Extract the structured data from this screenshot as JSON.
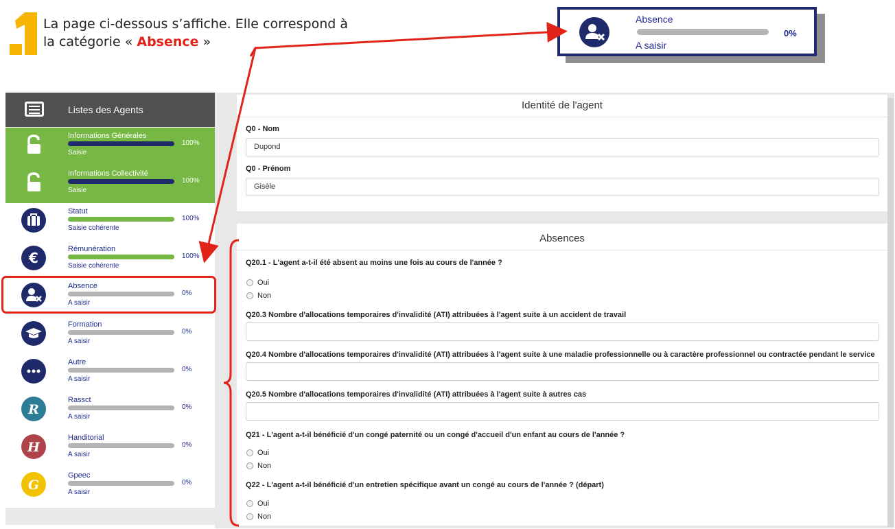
{
  "instruction": {
    "step_number": "1",
    "line1": "La page ci-dessous s’affiche. Elle correspond à",
    "line2_before": "la catégorie « ",
    "line2_highlight": "Absence",
    "line2_after": " »"
  },
  "callout": {
    "label": "Absence",
    "percent": "0%",
    "status": "A saisir",
    "progress": 0
  },
  "sidebar": {
    "header_title": "Listes des Agents",
    "items": [
      {
        "label": "Informations Générales",
        "percent": "100%",
        "status": "Saisie",
        "progress": 1.0,
        "icon": "unlock-icon"
      },
      {
        "label": "Informations Collectivité",
        "percent": "100%",
        "status": "Saisie",
        "progress": 1.0,
        "icon": "unlock-icon"
      },
      {
        "label": "Statut",
        "percent": "100%",
        "status": "Saisie cohérente",
        "progress": 1.0,
        "icon": "briefcase-icon"
      },
      {
        "label": "Rémunération",
        "percent": "100%",
        "status": "Saisie cohérente",
        "progress": 1.0,
        "icon": "euro-icon"
      },
      {
        "label": "Absence",
        "percent": "0%",
        "status": "A saisir",
        "progress": 0,
        "icon": "user-x-icon"
      },
      {
        "label": "Formation",
        "percent": "0%",
        "status": "A saisir",
        "progress": 0,
        "icon": "graduation-cap-icon"
      },
      {
        "label": "Autre",
        "percent": "0%",
        "status": "A saisir",
        "progress": 0,
        "icon": "ellipsis-icon"
      },
      {
        "label": "Rassct",
        "percent": "0%",
        "status": "A saisir",
        "progress": 0,
        "icon": "letter-r-icon",
        "icon_letter": "R"
      },
      {
        "label": "Handitorial",
        "percent": "0%",
        "status": "A saisir",
        "progress": 0,
        "icon": "letter-h-icon",
        "icon_letter": "H"
      },
      {
        "label": "Gpeec",
        "percent": "0%",
        "status": "A saisir",
        "progress": 0,
        "icon": "letter-g-icon",
        "icon_letter": "G"
      }
    ]
  },
  "identity": {
    "title": "Identité de l'agent",
    "nom_label": "Q0 - Nom",
    "nom_value": "Dupond",
    "prenom_label": "Q0 - Prénom",
    "prenom_value": "Gisèle"
  },
  "absences": {
    "title": "Absences",
    "q20_1": "Q20.1 - L'agent a-t-il été absent au moins une fois au cours de l'année ?",
    "q20_3": "Q20.3 Nombre d'allocations temporaires d'invalidité (ATI) attribuées à l'agent suite à un accident de travail",
    "q20_4": "Q20.4 Nombre d'allocations temporaires d'invalidité (ATI) attribuées à l'agent suite à une maladie professionnelle ou à caractère professionnel ou contractée pendant le service",
    "q20_5": "Q20.5 Nombre d'allocations temporaires d'invalidité (ATI) attribuées à l'agent suite à autres cas",
    "q21": "Q21 - L'agent a-t-il bénéficié d'un congé paternité ou un congé d'accueil d'un enfant au cours de l'année ?",
    "q22": "Q22 - L'agent a-t-il bénéficié d'un entretien spécifique avant un congé au cours de l'année ? (départ)",
    "oui": "Oui",
    "non": "Non"
  },
  "colors": {
    "navy": "#1f2a6b",
    "green": "#77b844",
    "annotation_red": "#e2231a",
    "rassct": "#2d7d96",
    "handitorial": "#b0434a",
    "gpeec": "#f2c200",
    "step_yellow": "#f4b400"
  }
}
